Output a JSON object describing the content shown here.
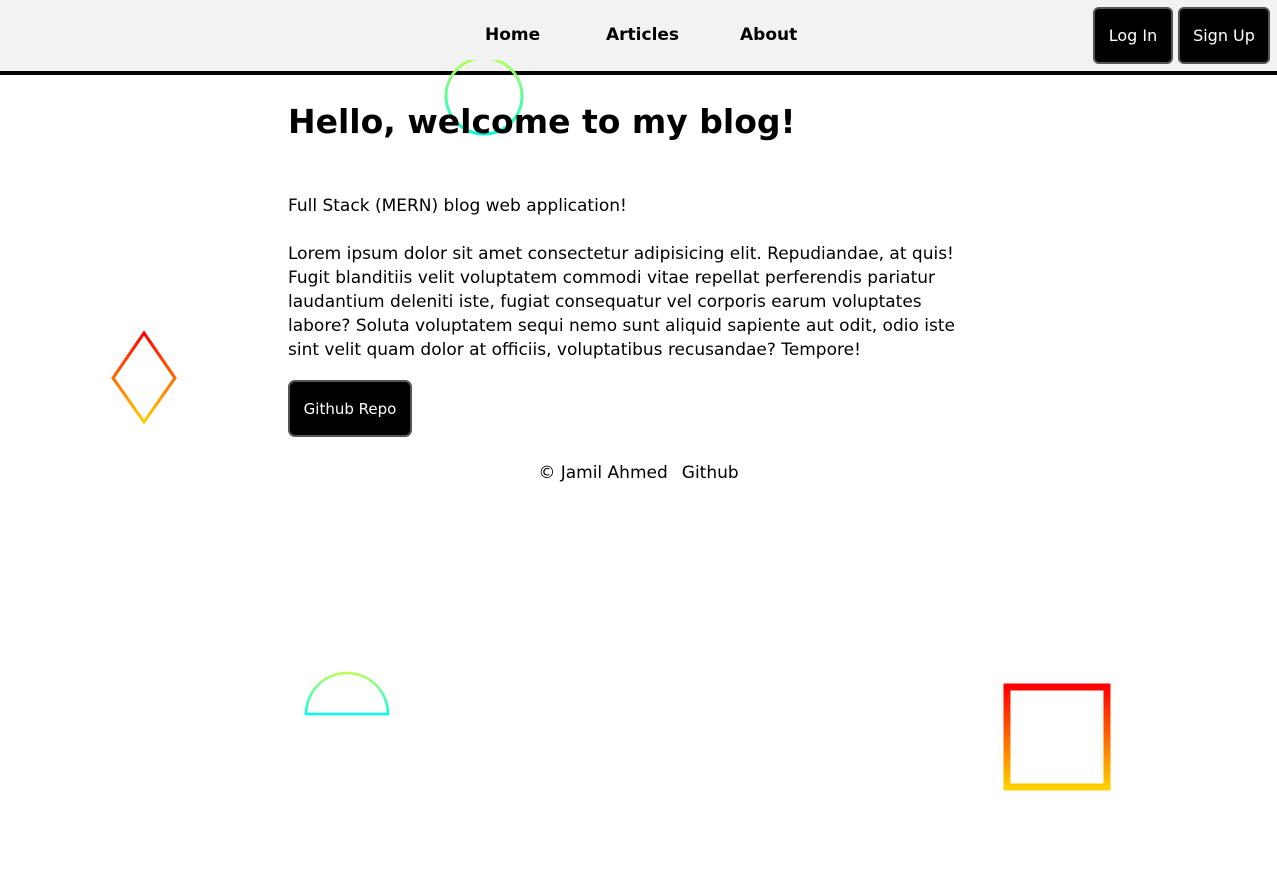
{
  "nav": {
    "home": "Home",
    "articles": "Articles",
    "about": "About"
  },
  "auth": {
    "login": "Log In",
    "signup": "Sign Up"
  },
  "main": {
    "title": "Hello, welcome to my blog!",
    "subtitle": "Full Stack (MERN) blog web application!",
    "body": "Lorem ipsum dolor sit amet consectetur adipisicing elit. Repudiandae, at quis! Fugit blanditiis velit voluptatem commodi vitae repellat perferendis pariatur laudantium deleniti iste, fugiat consequatur vel corporis earum voluptates labore? Soluta voluptatem sequi nemo sunt aliquid sapiente aut odit, odio iste sint velit quam dolor at officiis, voluptatibus recusandae? Tempore!",
    "repo_button": "Github Repo"
  },
  "footer": {
    "copyright": "© Jamil Ahmed",
    "github": "Github"
  },
  "colors": {
    "header_bg": "#f2f2f2",
    "button_bg": "#000000",
    "warm_start": "#ff0000",
    "warm_end": "#ffd000",
    "cool_start": "#b6ff5a",
    "cool_end": "#00ffe0"
  }
}
